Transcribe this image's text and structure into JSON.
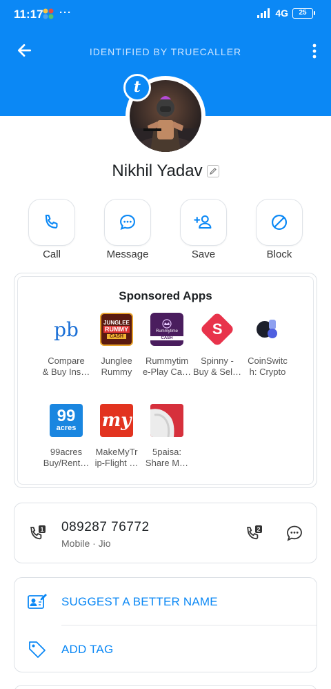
{
  "status_bar": {
    "time": "11:17",
    "dots": "···",
    "network": "4G",
    "battery": "25"
  },
  "topbar": {
    "title": "IDENTIFIED BY TRUECALLER",
    "back_icon": "arrow-left-icon",
    "more_icon": "more-vertical-icon"
  },
  "profile": {
    "badge_letter": "t",
    "name": "Nikhil Yadav"
  },
  "actions": [
    {
      "label": "Call",
      "icon": "phone-icon"
    },
    {
      "label": "Message",
      "icon": "chat-bubble-icon"
    },
    {
      "label": "Save",
      "icon": "add-person-icon"
    },
    {
      "label": "Block",
      "icon": "block-icon"
    }
  ],
  "sponsored": {
    "title": "Sponsored Apps",
    "apps": [
      {
        "line1": "Compare",
        "line2": "& Buy Ins…"
      },
      {
        "line1": "Junglee",
        "line2": "Rummy"
      },
      {
        "line1": "Rummytim",
        "line2": "e-Play Ca…"
      },
      {
        "line1": "Spinny -",
        "line2": "Buy & Sel…"
      },
      {
        "line1": "CoinSwitc",
        "line2": "h: Crypto"
      },
      {
        "line1": "99acres",
        "line2": "Buy/Rent…"
      },
      {
        "line1": "MakeMyTr",
        "line2": "ip-Flight …"
      },
      {
        "line1": "5paisa:",
        "line2": "Share M…"
      }
    ],
    "icon_text": {
      "pb": "pb",
      "junglee_top": "JUNGLEE",
      "junglee_mid": "RUMMY",
      "junglee_bot": "CASH",
      "rummytime": "Rummytime",
      "rummytime_cash": "CASH",
      "spinny": "S",
      "acres_num": "99",
      "acres_word": "acres",
      "mmt": "my"
    }
  },
  "number": {
    "value": "089287 76772",
    "sub": "Mobile · Jio",
    "sim1_badge": "1",
    "sim2_badge": "2"
  },
  "options": [
    {
      "label": "SUGGEST A BETTER NAME",
      "icon": "edit-contact-icon"
    },
    {
      "label": "ADD TAG",
      "icon": "tag-icon"
    }
  ],
  "colors": {
    "brand": "#0b88f5",
    "background": "#ffffff"
  }
}
